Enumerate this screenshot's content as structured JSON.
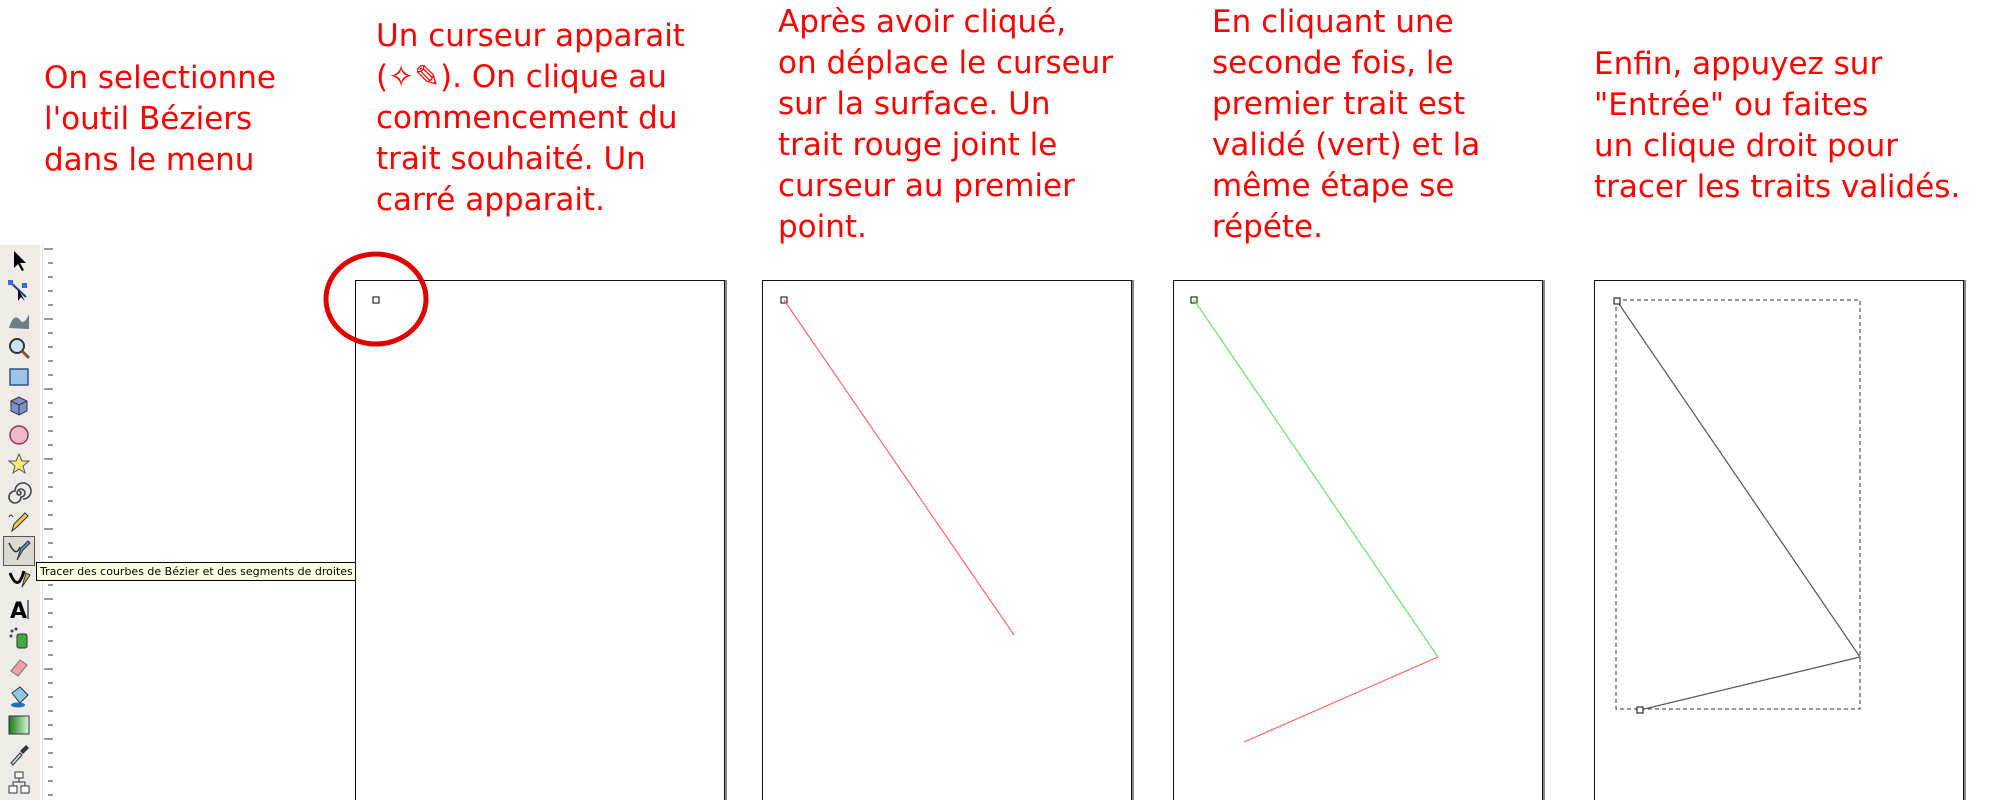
{
  "captions": [
    [
      "On selectionne",
      "l'outil Béziers",
      "dans le menu"
    ],
    [
      "Un curseur apparait",
      "(✧✎). On clique au",
      "commencement du",
      "trait souhaité. Un",
      "carré apparait."
    ],
    [
      "Après avoir cliqué,",
      "on déplace le curseur",
      "sur la surface. Un",
      "trait rouge joint le",
      "curseur au premier",
      "point."
    ],
    [
      "En cliquant une",
      "seconde fois, le",
      "premier trait est",
      "validé (vert) et la",
      "même étape se",
      "répéte."
    ],
    [
      "Enfin, appuyez sur",
      "\"Entrée\" ou faites",
      "un clique droit pour",
      "tracer les traits validés."
    ]
  ],
  "tooltip": "Tracer des courbes de Bézier et des segments de droites",
  "tools": [
    {
      "name": "selector-icon"
    },
    {
      "name": "node-editor-icon"
    },
    {
      "name": "tweak-icon"
    },
    {
      "name": "zoom-icon"
    },
    {
      "name": "rectangle-icon"
    },
    {
      "name": "3d-box-icon"
    },
    {
      "name": "ellipse-icon"
    },
    {
      "name": "star-icon"
    },
    {
      "name": "spiral-icon"
    },
    {
      "name": "pencil-icon"
    },
    {
      "name": "bezier-pen-icon",
      "active": true
    },
    {
      "name": "calligraphy-icon"
    },
    {
      "name": "text-icon"
    },
    {
      "name": "spray-icon"
    },
    {
      "name": "eraser-icon"
    },
    {
      "name": "paint-bucket-icon"
    },
    {
      "name": "gradient-icon"
    },
    {
      "name": "dropper-icon"
    },
    {
      "name": "connector-icon"
    }
  ],
  "colors": {
    "caption": "#ff0000",
    "pending_stroke": "#ff6666",
    "validated_stroke": "#7fe07f",
    "final_stroke": "#555555",
    "highlight_circle": "#e00000"
  }
}
